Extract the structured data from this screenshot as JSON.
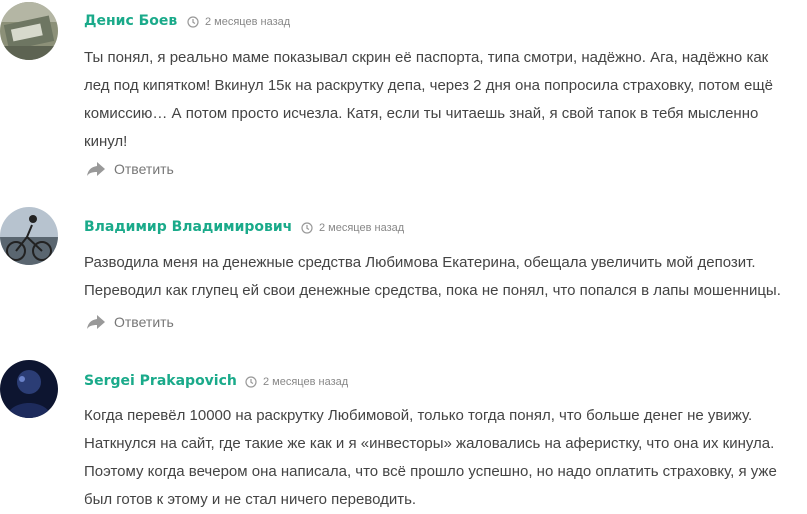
{
  "comments": [
    {
      "author": "Денис Боев",
      "time": "2 месяцев назад",
      "lines": [
        "Ты понял, я реально маме показывал скрин её паспорта, типа смотри, надёжно. Ага, надёжно как",
        "лед под кипятком! Вкинул 15к на раскрутку депа, через 2 дня она попросила страховку, потом ещё",
        "комиссию… А потом просто исчезла. Катя, если ты читаешь знай, я свой тапок в тебя мысленно",
        "кинул!"
      ],
      "reply": "Ответить"
    },
    {
      "author": "Владимир Владимирович",
      "time": "2 месяцев назад",
      "lines": [
        "Разводила меня на денежные средства Любимова Екатерина, обещала увеличить мой депозит.",
        "Переводил как глупец ей свои денежные средства, пока не понял, что попался в лапы мошенницы."
      ],
      "reply": "Ответить"
    },
    {
      "author": "Sergei Prakapovich",
      "time": "2 месяцев назад",
      "lines": [
        "Когда перевёл 10000 на раскрутку Любимовой, только тогда понял, что больше денег не увижу.",
        "Наткнулся на сайт, где такие же как и я «инвесторы» жаловались на аферистку, что она их кинула.",
        "Поэтому когда вечером она написала, что всё прошло успешно, но надо оплатить страховку, я уже",
        "был готов к этому и не стал ничего переводить."
      ]
    }
  ],
  "icons": {
    "time": "clock-icon",
    "reply": "reply-arrow-icon"
  },
  "colors": {
    "author": "#1aaa8a",
    "text": "#444444",
    "meta": "#888888"
  }
}
